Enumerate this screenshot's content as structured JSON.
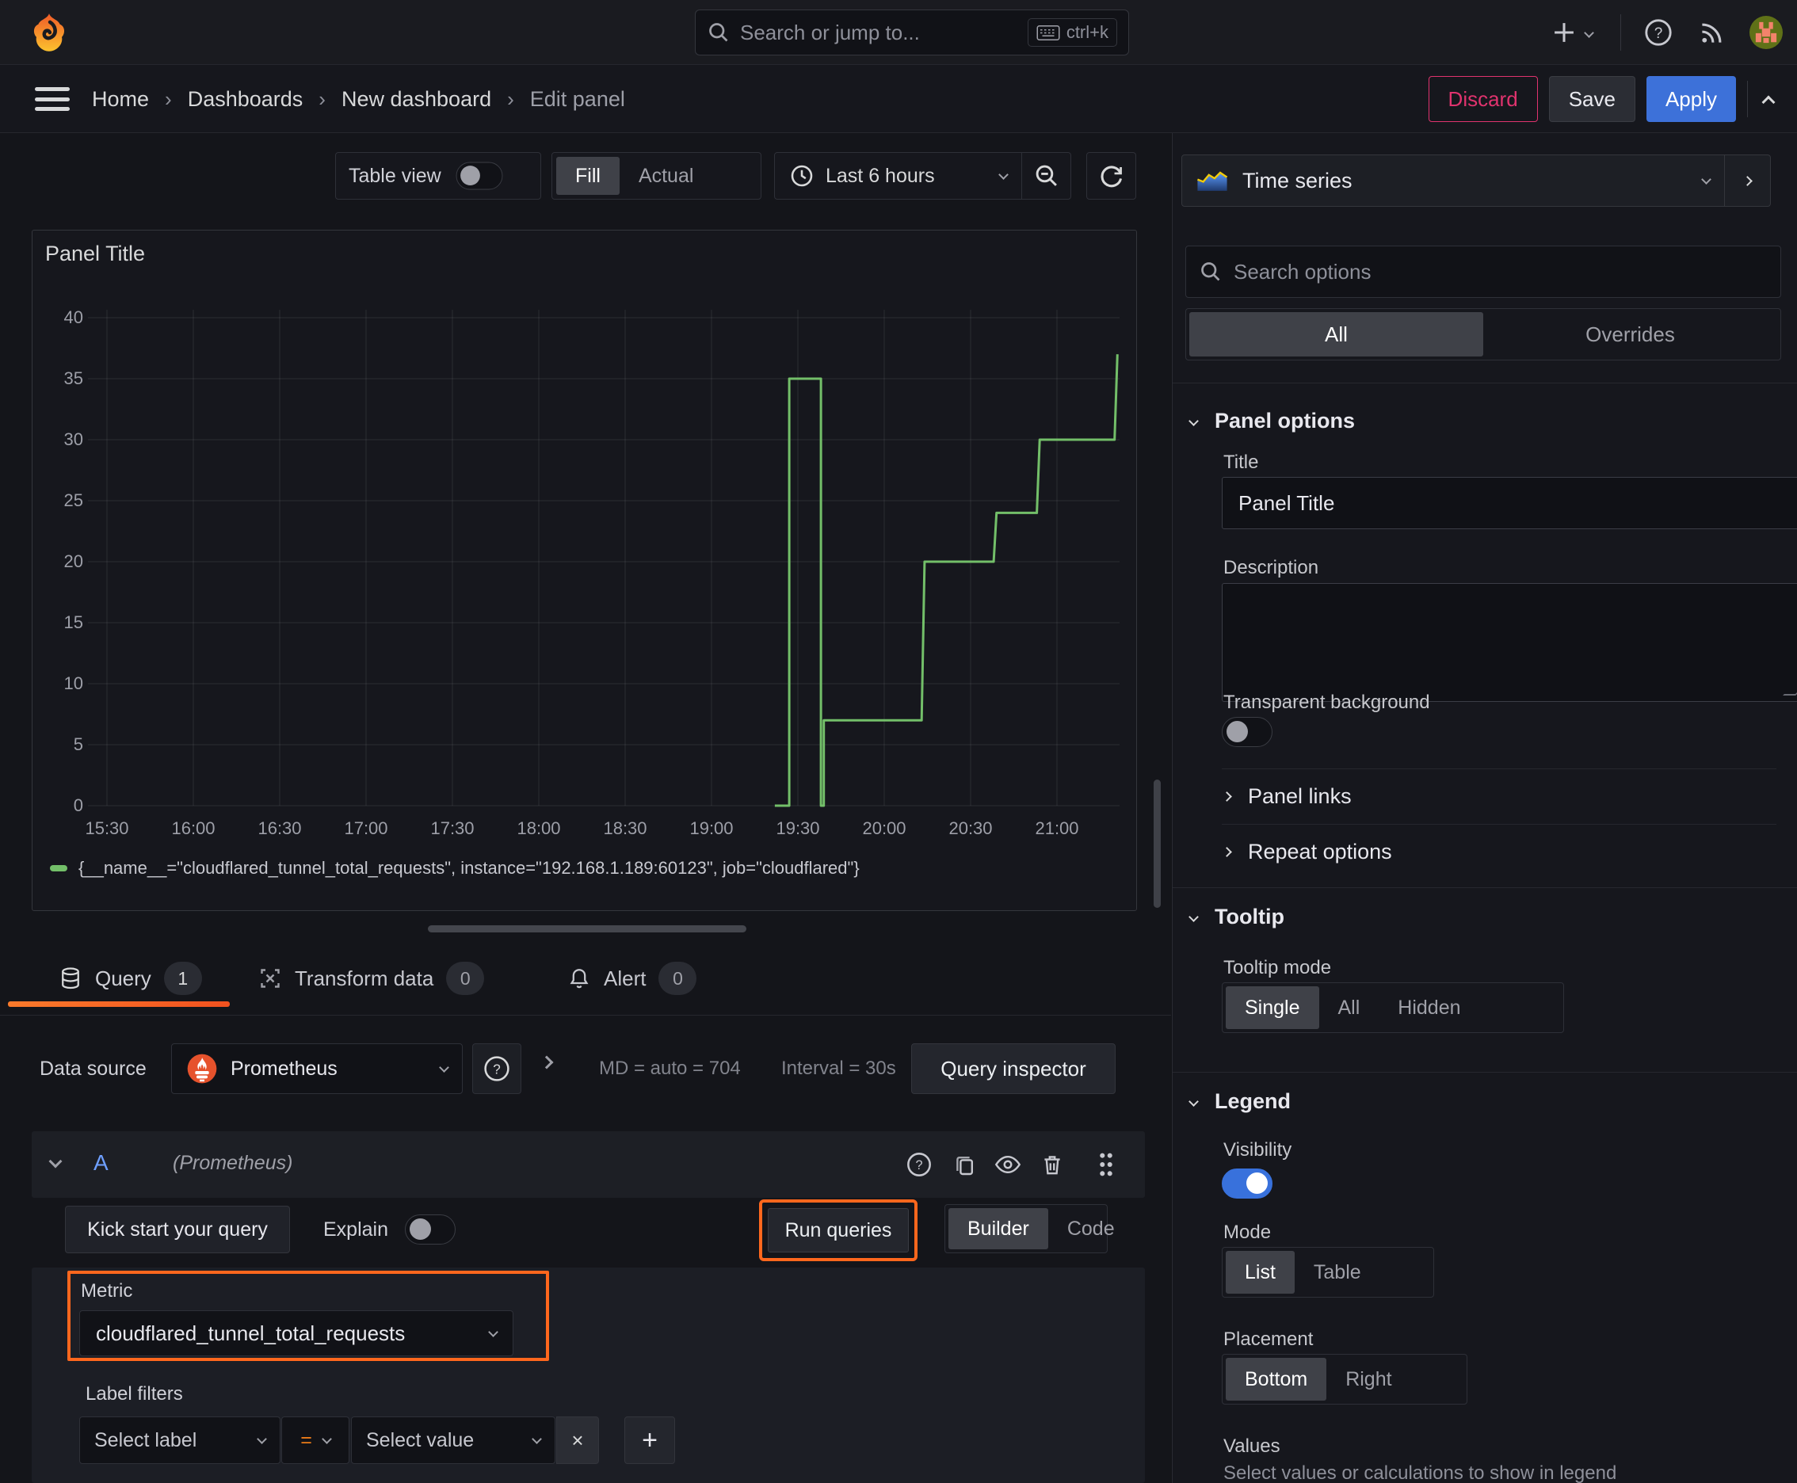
{
  "topbar": {
    "search_placeholder": "Search or jump to...",
    "shortcut": "ctrl+k"
  },
  "breadcrumb": {
    "items": [
      "Home",
      "Dashboards",
      "New dashboard",
      "Edit panel"
    ]
  },
  "header_actions": {
    "discard": "Discard",
    "save": "Save",
    "apply": "Apply"
  },
  "toolbar": {
    "table_view": "Table view",
    "fill": "Fill",
    "actual": "Actual",
    "time_range": "Last 6 hours"
  },
  "viz_picker": {
    "label": "Time series"
  },
  "panel": {
    "title": "Panel Title"
  },
  "chart_data": {
    "type": "line",
    "title": "Panel Title",
    "x_ticks": [
      "15:30",
      "16:00",
      "16:30",
      "17:00",
      "17:30",
      "18:00",
      "18:30",
      "19:00",
      "19:30",
      "20:00",
      "20:30",
      "21:00"
    ],
    "y_ticks": [
      0,
      5,
      10,
      15,
      20,
      25,
      30,
      35,
      40
    ],
    "ylim": [
      0,
      40
    ],
    "x_range": [
      "15:23",
      "21:22"
    ],
    "grid": true,
    "legend_position": "bottom",
    "series": [
      {
        "name": "{__name__=\"cloudflared_tunnel_total_requests\", instance=\"192.168.1.189:60123\", job=\"cloudflared\"}",
        "color": "#73bf69",
        "points": [
          [
            "19:22",
            0
          ],
          [
            "19:27",
            0
          ],
          [
            "19:27",
            35
          ],
          [
            "19:38",
            35
          ],
          [
            "19:38",
            0
          ],
          [
            "19:39",
            0
          ],
          [
            "19:39",
            7
          ],
          [
            "20:13",
            7
          ],
          [
            "20:14",
            20
          ],
          [
            "20:38",
            20
          ],
          [
            "20:39",
            24
          ],
          [
            "20:53",
            24
          ],
          [
            "20:54",
            30
          ],
          [
            "21:20",
            30
          ],
          [
            "21:21",
            37
          ]
        ]
      }
    ]
  },
  "tabs": {
    "query": "Query",
    "query_count": "1",
    "transform": "Transform data",
    "transform_count": "0",
    "alert": "Alert",
    "alert_count": "0"
  },
  "datasource_row": {
    "label": "Data source",
    "value": "Prometheus",
    "md": "MD = auto = 704",
    "interval": "Interval = 30s",
    "inspector": "Query inspector"
  },
  "query_row": {
    "ref": "A",
    "ds": "(Prometheus)"
  },
  "query_toolbar": {
    "kickstart": "Kick start your query",
    "explain": "Explain",
    "run": "Run queries",
    "builder": "Builder",
    "code": "Code"
  },
  "metric": {
    "label": "Metric",
    "value": "cloudflared_tunnel_total_requests"
  },
  "label_filters": {
    "label": "Label filters",
    "select_label": "Select label",
    "operator": "=",
    "select_value": "Select value",
    "remove": "×",
    "add": "+"
  },
  "options": {
    "search_placeholder": "Search options",
    "tab_all": "All",
    "tab_overrides": "Overrides",
    "panel_options": {
      "title": "Panel options",
      "title_label": "Title",
      "title_value": "Panel Title",
      "description_label": "Description",
      "transparent": "Transparent background"
    },
    "links": "Panel links",
    "repeat": "Repeat options",
    "tooltip": {
      "title": "Tooltip",
      "mode_label": "Tooltip mode",
      "modes": [
        "Single",
        "All",
        "Hidden"
      ]
    },
    "legend": {
      "title": "Legend",
      "visibility": "Visibility",
      "mode_label": "Mode",
      "modes": [
        "List",
        "Table"
      ],
      "placement_label": "Placement",
      "placements": [
        "Bottom",
        "Right"
      ],
      "values_label": "Values",
      "values_desc": "Select values or calculations to show in legend"
    }
  }
}
